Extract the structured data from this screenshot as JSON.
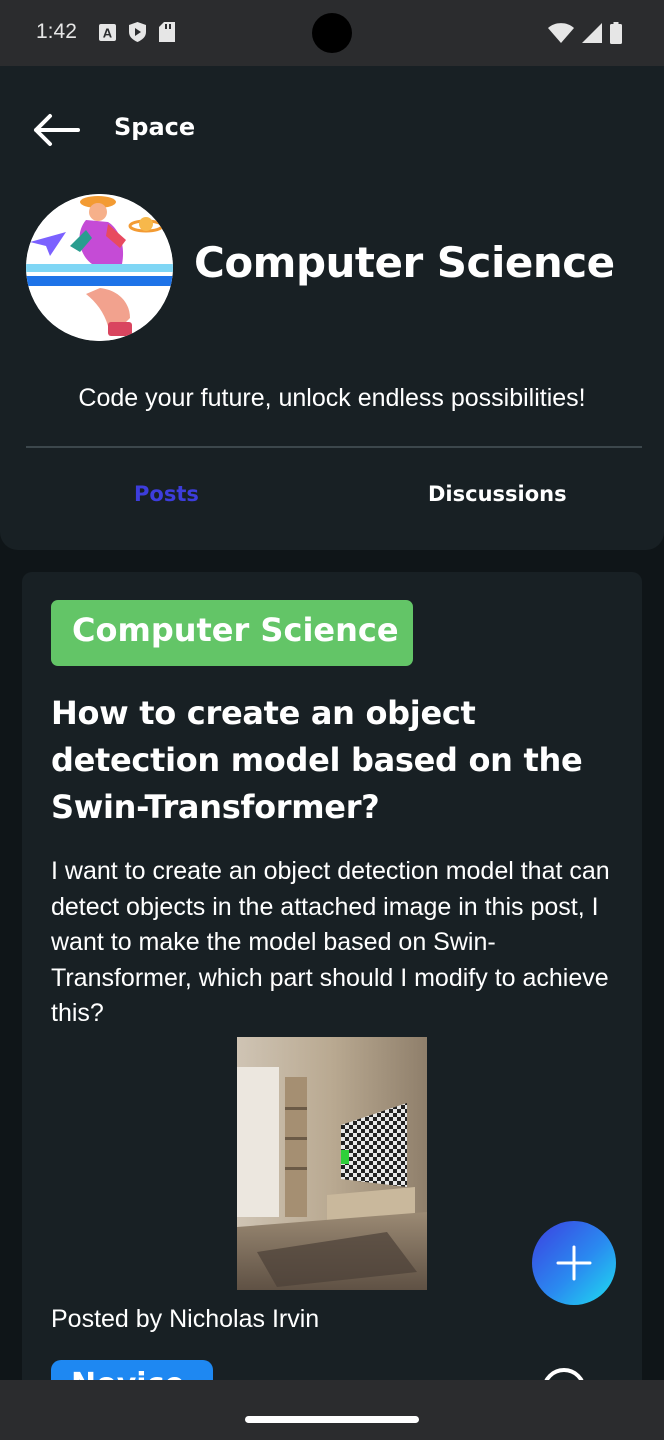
{
  "status_bar": {
    "time": "1:42",
    "left_icons": [
      "a-letter-icon",
      "shield-play-icon",
      "sd-card-icon"
    ],
    "right_icons": [
      "wifi-icon",
      "signal-icon",
      "battery-icon"
    ]
  },
  "header": {
    "back_icon": "arrow-left-icon",
    "title": "Space"
  },
  "space": {
    "name": "Computer Science",
    "description": "Code your future, unlock endless possibilities!"
  },
  "tabs": [
    {
      "label": "Posts",
      "active": true,
      "color": "#3d3ddc"
    },
    {
      "label": "Discussions",
      "active": false,
      "color": "#ffffff"
    }
  ],
  "post": {
    "category": "Computer Science",
    "category_color": "#63c567",
    "title": "How to create an object detection model based on the Swin-Transformer?",
    "body": "I want to create an object detection model that can detect objects in the attached image in this post, I want to make the model based on Swin-Transformer, which part should I modify to achieve this?",
    "posted_by": "Posted by Nicholas Irvin",
    "level_badge": "Novice",
    "level_color": "#1e88f2"
  },
  "fab": {
    "icon": "plus-icon"
  }
}
